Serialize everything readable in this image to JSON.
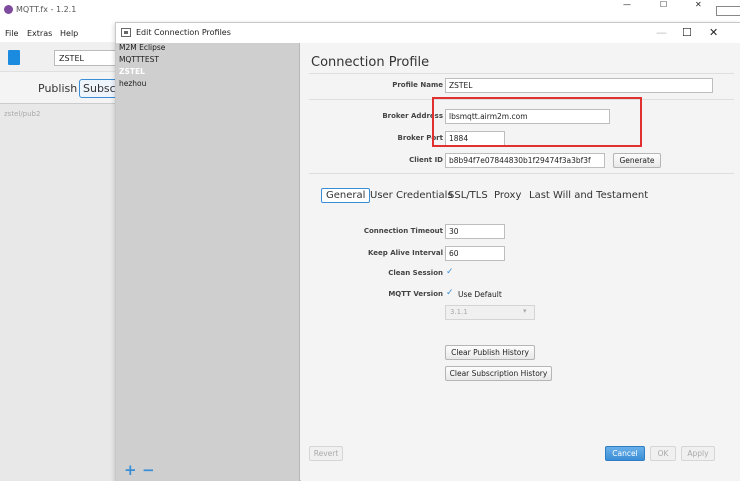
{
  "background_app": {
    "title": "MQTT.fx - 1.2.1",
    "menu": [
      "File",
      "Extras",
      "Help"
    ],
    "profile_select": "ZSTEL",
    "tabs": {
      "publish": "Publish",
      "subscribe": "Subscribe"
    },
    "topic": "zstel/pub2",
    "window_buttons": {
      "minimize": "—",
      "maximize": "☐",
      "close": "✕"
    }
  },
  "dialog": {
    "title": "Edit Connection Profiles",
    "window_buttons": {
      "minimize": "—",
      "maximize": "☐",
      "close": "✕"
    },
    "profiles": [
      "M2M Eclipse",
      "MQTTTEST",
      "ZSTEL",
      "hezhou"
    ],
    "selected_profile": "ZSTEL",
    "add_label": "+",
    "remove_label": "−",
    "heading": "Connection Profile",
    "profile_name_label": "Profile Name",
    "profile_name": "ZSTEL",
    "broker_address_label": "Broker Address",
    "broker_address": "lbsmqtt.airm2m.com",
    "broker_port_label": "Broker Port",
    "broker_port": "1884",
    "client_id_label": "Client ID",
    "client_id": "b8b94f7e07844830b1f29474f3a3bf3f",
    "generate_label": "Generate",
    "tabs": [
      "General",
      "User Credentials",
      "SSL/TLS",
      "Proxy",
      "Last Will and Testament"
    ],
    "active_tab": "General",
    "general": {
      "connection_timeout_label": "Connection Timeout",
      "connection_timeout": "30",
      "keep_alive_label": "Keep Alive Interval",
      "keep_alive": "60",
      "clean_session_label": "Clean Session",
      "clean_session": true,
      "mqtt_version_label": "MQTT Version",
      "use_default_label": "Use Default",
      "use_default": true,
      "version_value": "3.1.1",
      "clear_publish_label": "Clear Publish History",
      "clear_subscription_label": "Clear Subscription History"
    },
    "footer": {
      "revert": "Revert",
      "cancel": "Cancel",
      "ok": "OK",
      "apply": "Apply"
    }
  },
  "colors": {
    "accent": "#3a8ed6",
    "highlight": "#e0302f",
    "list_bg": "#cfcfcf"
  }
}
